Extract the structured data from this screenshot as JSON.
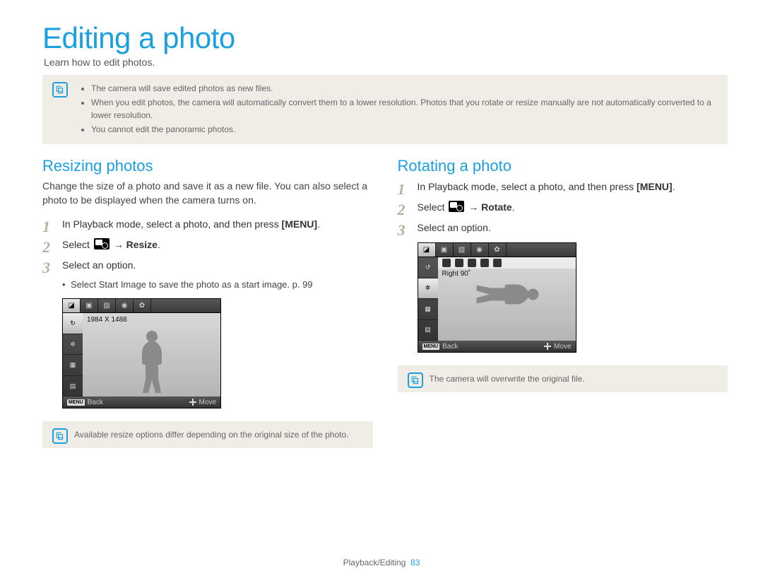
{
  "page": {
    "title": "Editing a photo",
    "subtitle": "Learn how to edit photos.",
    "footer_section": "Playback/Editing",
    "footer_page": "83"
  },
  "top_note": {
    "items": [
      "The camera will save edited photos as new files.",
      "When you edit photos, the camera will automatically convert them to a lower resolution. Photos that you rotate or resize manually are not automatically converted to a lower resolution.",
      "You cannot edit the panoramic photos."
    ]
  },
  "resize": {
    "heading": "Resizing photos",
    "desc": "Change the size of a photo and save it as a new file. You can also select a photo to be displayed when the camera turns on.",
    "step1_a": "In Playback mode, select a photo, and then press ",
    "step1_menu": "[MENU]",
    "step1_b": ".",
    "step2_a": "Select ",
    "step2_arrow": " → ",
    "step2_target": "Resize",
    "step2_b": ".",
    "step3": "Select an option.",
    "sub_a": "Select ",
    "sub_bold": "Start Image",
    "sub_b": " to save the photo as a start image. p. 99",
    "shot_label": "1984 X 1488",
    "shot_back": "Back",
    "shot_move": "Move",
    "note": "Available resize options differ depending on the original size of the photo."
  },
  "rotate": {
    "heading": "Rotating a photo",
    "step1_a": "In Playback mode, select a photo, and then press ",
    "step1_menu": "[MENU]",
    "step1_b": ".",
    "step2_a": "Select ",
    "step2_arrow": " → ",
    "step2_target": "Rotate",
    "step2_b": ".",
    "step3": "Select an option.",
    "shot_label": "Right 90˚",
    "shot_back": "Back",
    "shot_move": "Move",
    "note": "The camera will overwrite the original file."
  }
}
